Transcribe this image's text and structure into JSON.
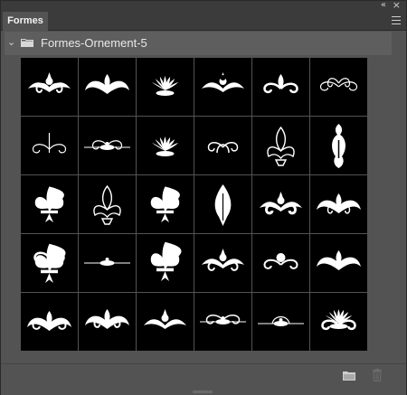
{
  "panel": {
    "tab_label": "Formes",
    "collapse_glyph": "«",
    "close_glyph": "×",
    "menu_icon": "hamburger-menu-icon"
  },
  "group": {
    "expanded": true,
    "folder_icon": "folder-icon",
    "label": "Formes-Ornement-5"
  },
  "shapes": [
    {
      "icon": "ornament-01"
    },
    {
      "icon": "ornament-02"
    },
    {
      "icon": "ornament-03"
    },
    {
      "icon": "ornament-04"
    },
    {
      "icon": "ornament-05"
    },
    {
      "icon": "ornament-06"
    },
    {
      "icon": "ornament-07"
    },
    {
      "icon": "ornament-08"
    },
    {
      "icon": "ornament-09"
    },
    {
      "icon": "ornament-10"
    },
    {
      "icon": "ornament-11"
    },
    {
      "icon": "ornament-12"
    },
    {
      "icon": "ornament-13"
    },
    {
      "icon": "ornament-14"
    },
    {
      "icon": "ornament-15"
    },
    {
      "icon": "ornament-16"
    },
    {
      "icon": "ornament-17"
    },
    {
      "icon": "ornament-18"
    },
    {
      "icon": "ornament-19"
    },
    {
      "icon": "ornament-20"
    },
    {
      "icon": "ornament-21"
    },
    {
      "icon": "ornament-22"
    },
    {
      "icon": "ornament-23"
    },
    {
      "icon": "ornament-24"
    },
    {
      "icon": "ornament-25"
    },
    {
      "icon": "ornament-26"
    },
    {
      "icon": "ornament-27"
    },
    {
      "icon": "ornament-28"
    },
    {
      "icon": "ornament-29"
    },
    {
      "icon": "ornament-30"
    }
  ],
  "footer": {
    "new_group_icon": "new-group-folder-icon",
    "delete_icon": "trash-icon"
  },
  "colors": {
    "panel_bg": "#535353",
    "tab_bar_bg": "#3b3b3b",
    "thumb_bg": "#000000",
    "shape_fill": "#ffffff"
  }
}
